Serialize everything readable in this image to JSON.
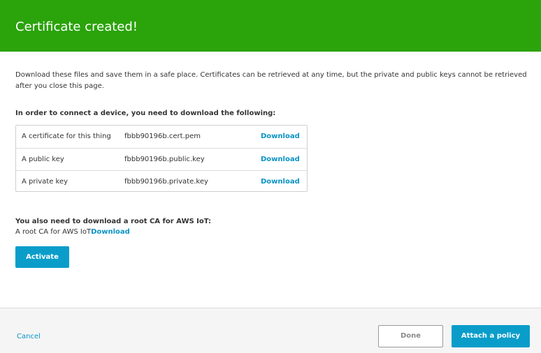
{
  "banner": {
    "title": "Certificate created!",
    "color": "#2ba30b"
  },
  "intro_text": "Download these files and save them in a safe place. Certificates can be retrieved at any time, but the private and public keys cannot be retrieved after you close this page.",
  "files_section": {
    "heading": "In order to connect a device, you need to download the following:",
    "rows": [
      {
        "description": "A certificate for this thing",
        "filename": "fbbb90196b.cert.pem",
        "action": "Download"
      },
      {
        "description": "A public key",
        "filename": "fbbb90196b.public.key",
        "action": "Download"
      },
      {
        "description": "A private key",
        "filename": "fbbb90196b.private.key",
        "action": "Download"
      }
    ]
  },
  "root_ca": {
    "heading": "You also need to download a root CA for AWS IoT:",
    "label": "A root CA for AWS IoT",
    "action": "Download"
  },
  "activate_button": "Activate",
  "footer": {
    "cancel": "Cancel",
    "done": "Done",
    "attach_policy": "Attach a policy"
  },
  "colors": {
    "accent": "#0a9dca",
    "link": "#0a94c4",
    "success": "#2ba30b"
  }
}
